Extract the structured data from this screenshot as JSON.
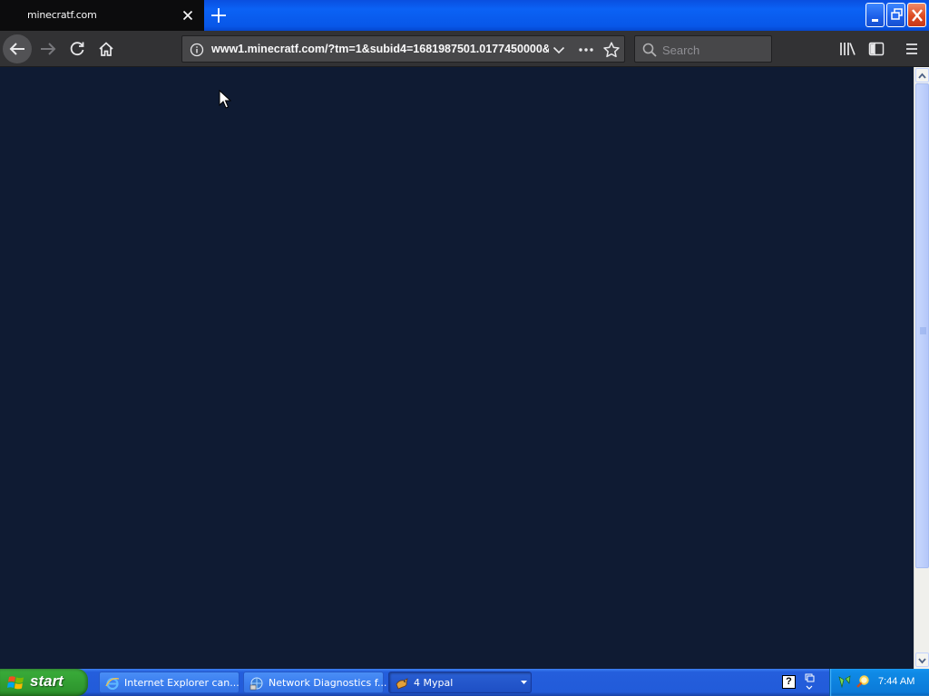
{
  "browser": {
    "tab": {
      "title": "minecratf.com"
    },
    "url": "www1.minecratf.com/?tm=1&subid4=1681987501.0177450000&",
    "search_placeholder": "Search"
  },
  "colors": {
    "page_background": "#0f1b33",
    "toolbar": "#323234",
    "xp_blue": "#245edc",
    "start_green": "#38a938"
  },
  "icons": {
    "window": [
      "minimize-icon",
      "restore-icon",
      "close-icon"
    ],
    "toolbar": [
      "back-icon",
      "forward-icon",
      "reload-icon",
      "home-icon",
      "info-icon",
      "dropdown-icon",
      "more-icon",
      "star-icon",
      "search-icon",
      "library-icon",
      "sidebar-icon",
      "menu-icon"
    ]
  },
  "taskbar": {
    "start_label": "start",
    "tasks": [
      {
        "label": "Internet Explorer can..."
      },
      {
        "label": "Network Diagnostics f..."
      },
      {
        "label": "4 Mypal"
      }
    ],
    "clock": "7:44 AM"
  }
}
